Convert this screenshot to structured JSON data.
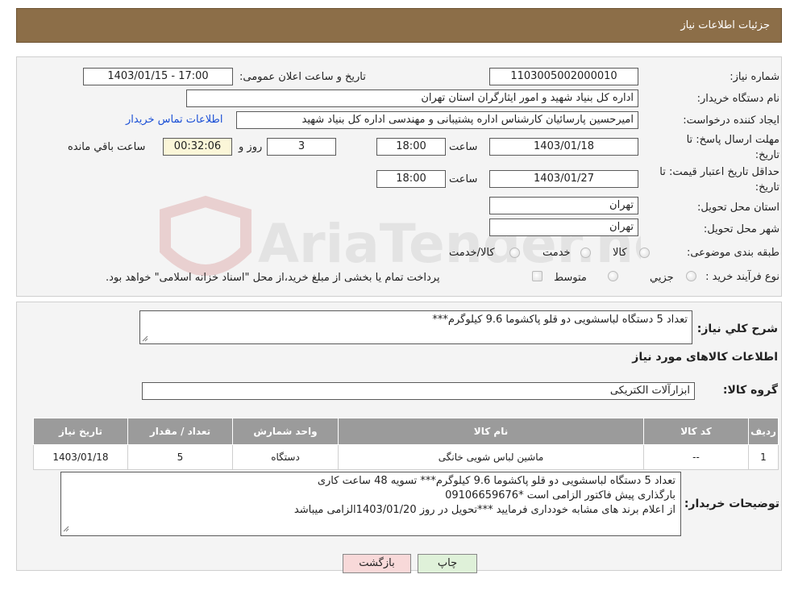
{
  "header": {
    "title": "جزئیات اطلاعات نیاز"
  },
  "need": {
    "number_label": "شماره نیاز:",
    "number": "1103005002000010",
    "announce_label": "تاریخ و ساعت اعلان عمومی:",
    "announce": "1403/01/15 - 17:00",
    "buyer_label": "نام دستگاه خریدار:",
    "buyer": "اداره کل بنیاد شهید و امور ایثارگران استان تهران",
    "creator_label": "ایجاد کننده درخواست:",
    "creator": "امیرحسین پارسائیان کارشناس اداره پشتیبانی و مهندسی  اداره کل بنیاد شهید",
    "contact_link": "اطلاعات تماس خریدار",
    "deadline_label_1": "مهلت ارسال پاسخ: تا",
    "deadline_label_2": "تاریخ:",
    "deadline_date": "1403/01/18",
    "time_label": "ساعت",
    "deadline_time": "18:00",
    "days": "3",
    "days_label": "روز و",
    "remaining": "00:32:06",
    "remaining_label": "ساعت باقي مانده",
    "validity_label_1": "حداقل تاریخ اعتبار قیمت: تا",
    "validity_label_2": "تاریخ:",
    "validity_date": "1403/01/27",
    "validity_time": "18:00",
    "province_label": "استان محل تحویل:",
    "province": "تهران",
    "city_label": "شهر محل تحویل:",
    "city": "تهران",
    "category_label": "طبقه بندی موضوعی:",
    "category_options": [
      "کالا",
      "خدمت",
      "کالا/خدمت"
    ],
    "process_label": "نوع فرآیند خرید :",
    "process_options": [
      "جزیي",
      "متوسط"
    ],
    "process_note": "پرداخت تمام یا بخشی از مبلغ خرید،از محل \"اسناد خزانه اسلامی\" خواهد بود."
  },
  "summary": {
    "desc_label": "شرح کلي نياز:",
    "desc": "تعداد 5 دستگاه لباسشویی دو قلو پاکشوما 9.6 کیلوگرم***",
    "goods_title": "اطلاعات کالاهای مورد نیاز",
    "group_label": "گروه کالا:",
    "group": "ابزارآلات الکتریکی"
  },
  "table": {
    "headers": [
      "ردیف",
      "کد کالا",
      "نام کالا",
      "واحد شمارش",
      "تعداد / مقدار",
      "تاریخ نیاز"
    ],
    "rows": [
      [
        "1",
        "--",
        "ماشین لباس شویی خانگی",
        "دستگاه",
        "5",
        "1403/01/18"
      ]
    ]
  },
  "notes": {
    "label": "توضیحات خریدار:",
    "lines": [
      "تعداد 5 دستگاه لباسشویی دو قلو پاکشوما 9.6 کیلوگرم*** تسویه 48 ساعت کاری",
      "بارگذاری پیش فاکتور الزامی است *09106659676",
      "از اعلام برند های مشابه خودداری فرمایید ***تحویل در روز 1403/01/20الزامی میباشد"
    ]
  },
  "buttons": {
    "print": "چاپ",
    "back": "بازگشت"
  },
  "watermark": {
    "text": "AriaTender.neT"
  },
  "colors": {
    "header": "#8c6e48",
    "table_header": "#9b9b9b",
    "back_button": "#f8d9d9",
    "print_button": "#dff1d9",
    "link": "#1a4fd6"
  }
}
